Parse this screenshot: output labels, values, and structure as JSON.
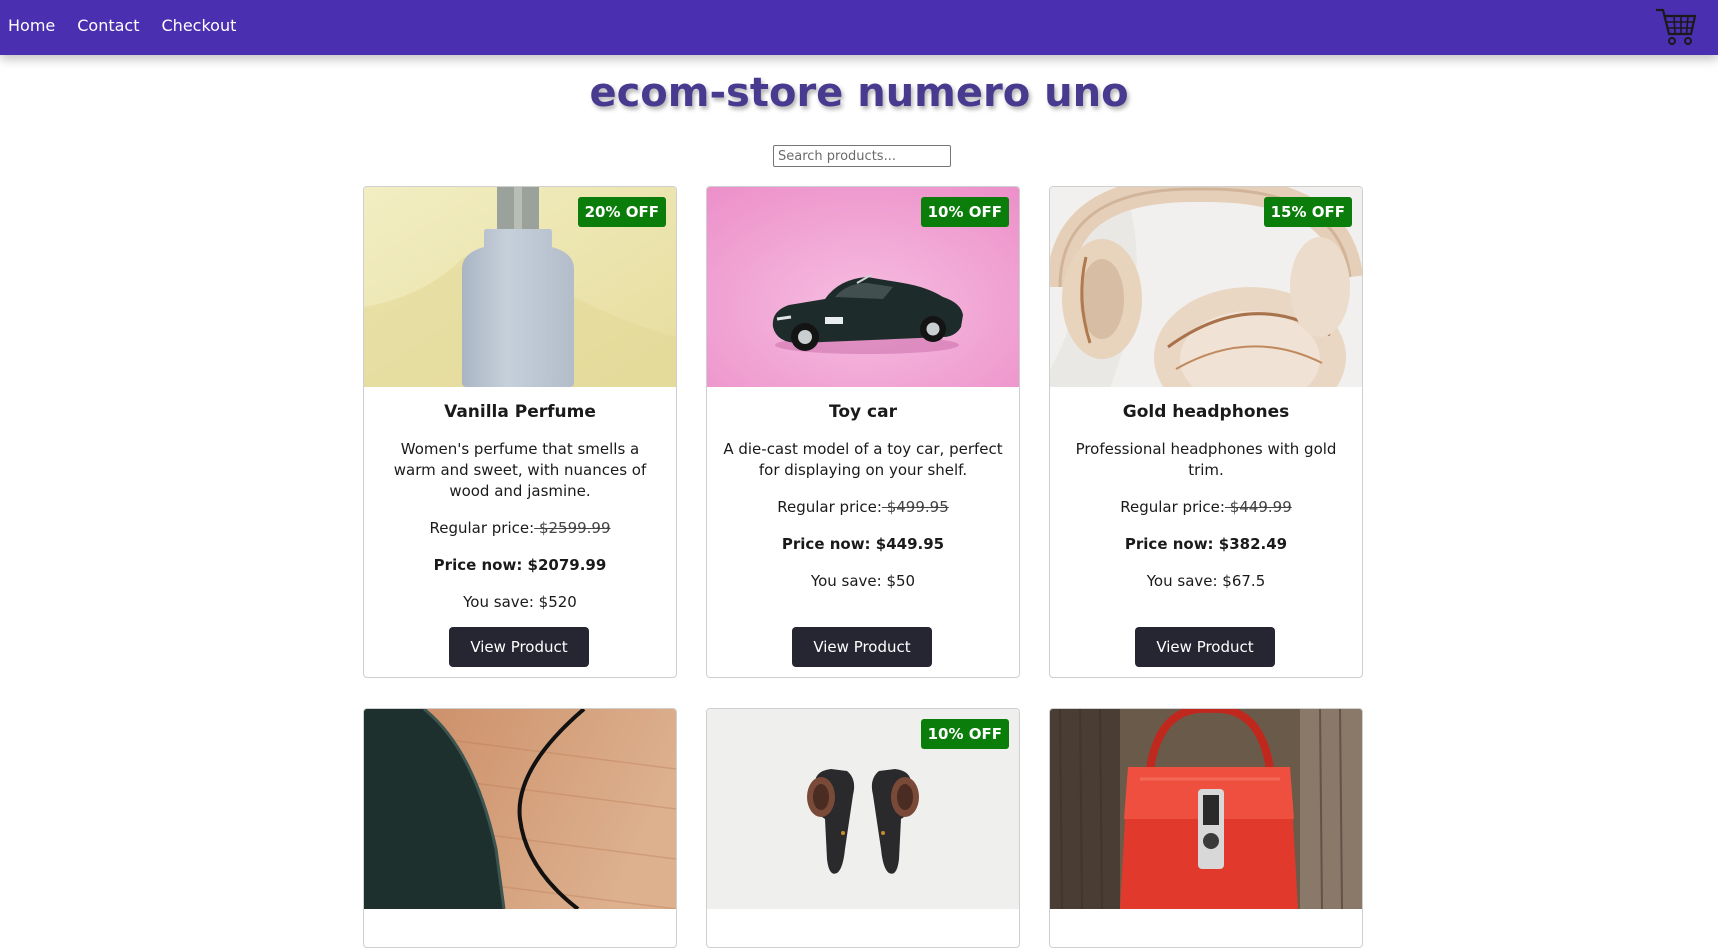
{
  "nav": {
    "links": [
      "Home",
      "Contact",
      "Checkout"
    ],
    "cart_icon": "shopping-cart-icon"
  },
  "page": {
    "title": "ecom-store numero uno"
  },
  "search": {
    "placeholder": "Search products..."
  },
  "products": [
    {
      "name": "Vanilla Perfume",
      "badge": "20% OFF",
      "description": "Women's perfume that smells a warm and sweet, with nuances of wood and jasmine.",
      "regular_label": "Regular price:",
      "regular_price": " $2599.99",
      "price_now": "Price now: $2079.99",
      "you_save": "You save: $520",
      "button": "View Product"
    },
    {
      "name": "Toy car",
      "badge": "10% OFF",
      "description": "A die-cast model of a toy car, perfect for displaying on your shelf.",
      "regular_label": "Regular price:",
      "regular_price": " $499.95",
      "price_now": "Price now: $449.95",
      "you_save": "You save: $50",
      "button": "View Product"
    },
    {
      "name": "Gold headphones",
      "badge": "15% OFF",
      "description": "Professional headphones with gold trim.",
      "regular_label": "Regular price:",
      "regular_price": " $449.99",
      "price_now": "Price now: $382.49",
      "you_save": "You save: $67.5",
      "button": "View Product"
    },
    {
      "badge": ""
    },
    {
      "badge": "10% OFF"
    },
    {
      "badge": ""
    }
  ],
  "colors": {
    "navbar": "#4a2fb0",
    "title": "#473a8f",
    "badge": "#0a7d0a",
    "button": "#262633"
  }
}
